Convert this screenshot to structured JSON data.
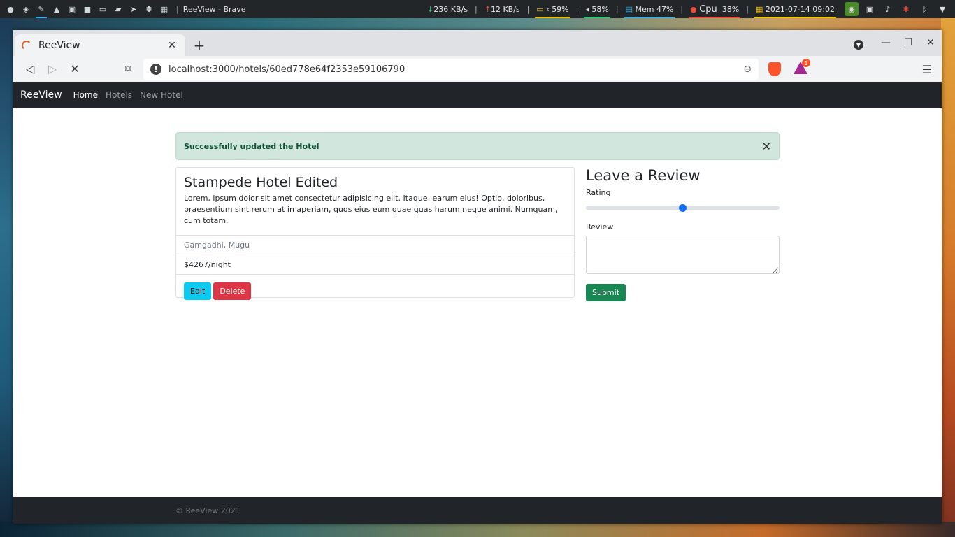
{
  "panel": {
    "window_title": "ReeView - Brave",
    "separator": "|",
    "download": "236 KB/s",
    "upload": "12 KB/s",
    "battery": "59%",
    "volume": "58%",
    "memory": "Mem 47%",
    "cpu_label": "Cpu",
    "cpu_value": "38%",
    "datetime": "2021-07-14 09:02",
    "colors": {
      "battery": "#f0c000",
      "volume": "#2ecc71",
      "memory": "#3daee9",
      "cpu": "#e74c3c",
      "datetime": "#f1c40f"
    }
  },
  "browser": {
    "tab_title": "ReeView",
    "url": "localhost:3000/hotels/60ed778e64f2353e59106790",
    "rewards_count": "1"
  },
  "navbar": {
    "brand": "ReeView",
    "links": [
      "Home",
      "Hotels",
      "New Hotel"
    ]
  },
  "alert": {
    "message": "Successfully updated the Hotel"
  },
  "hotel": {
    "title": "Stampede Hotel Edited",
    "description": "Lorem, ipsum dolor sit amet consectetur adipisicing elit. Itaque, earum eius! Optio, doloribus, praesentium sint rerum at in aperiam, quos eius eum quae quas harum neque animi. Numquam, cum totam.",
    "location": "Gamgadhi, Mugu",
    "price": "$4267/night",
    "edit_label": "Edit",
    "delete_label": "Delete"
  },
  "review_form": {
    "heading": "Leave a Review",
    "rating_label": "Rating",
    "rating_level": 0.5,
    "review_label": "Review",
    "submit_label": "Submit"
  },
  "footer": {
    "text": "© ReeView 2021"
  }
}
